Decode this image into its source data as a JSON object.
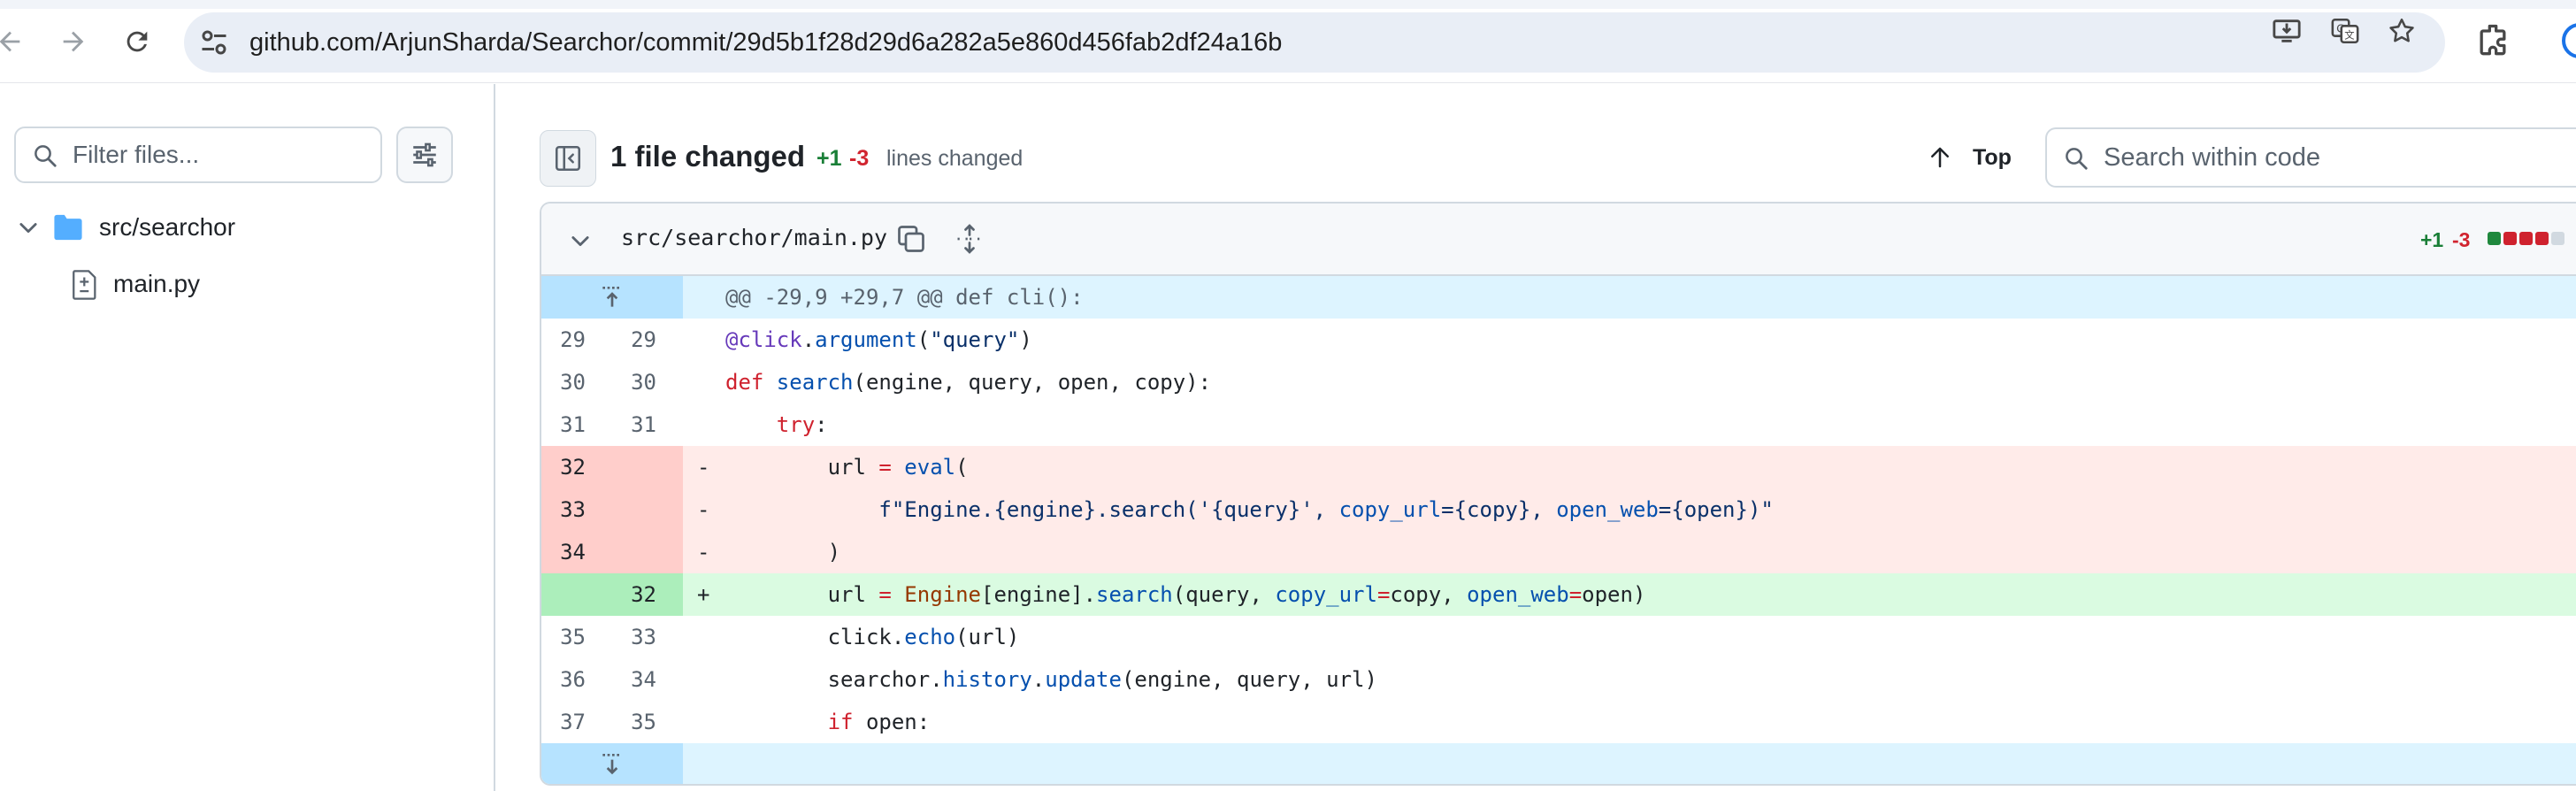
{
  "browser": {
    "url": "github.com/ArjunSharda/Searchor/commit/29d5b1f28d29d6a282a5e860d456fab2df24a16b",
    "icons": [
      "back-icon",
      "forward-icon",
      "reload-icon",
      "site-settings-icon",
      "install-app-icon",
      "translate-icon",
      "bookmark-star-icon",
      "extensions-icon"
    ]
  },
  "sidebar": {
    "filter_placeholder": "Filter files...",
    "tree": {
      "folder": "src/searchor",
      "file": "main.py"
    }
  },
  "header": {
    "files_changed": "1 file changed",
    "additions": "+1",
    "deletions": "-3",
    "lines_changed": "lines changed",
    "top_label": "Top",
    "search_placeholder": "Search within code"
  },
  "file": {
    "path": "src/searchor/main.py",
    "additions": "+1",
    "deletions": "-3",
    "diffstat_colors": [
      "#1f883d",
      "#cf222e",
      "#cf222e",
      "#cf222e",
      "#d1d9e0"
    ],
    "hunk_header": "@@ -29,9 +29,7 @@ def cli():"
  },
  "diff_lines": [
    {
      "type": "ctx",
      "old": "29",
      "new": "29",
      "marker": "",
      "tokens": [
        [
          "dec",
          "@click"
        ],
        [
          "",
          "."
        ],
        [
          "fn",
          "argument"
        ],
        [
          "",
          "("
        ],
        [
          "str",
          "\"query\""
        ],
        [
          "",
          ")"
        ]
      ]
    },
    {
      "type": "ctx",
      "old": "30",
      "new": "30",
      "marker": "",
      "tokens": [
        [
          "kw",
          "def "
        ],
        [
          "fn",
          "search"
        ],
        [
          "",
          "(engine, query, open, copy):"
        ]
      ]
    },
    {
      "type": "ctx",
      "old": "31",
      "new": "31",
      "marker": "",
      "tokens": [
        [
          "",
          "    "
        ],
        [
          "kw",
          "try"
        ],
        [
          "",
          ":"
        ]
      ]
    },
    {
      "type": "del",
      "old": "32",
      "new": "",
      "marker": "-",
      "tokens": [
        [
          "",
          "        url "
        ],
        [
          "kw",
          "="
        ],
        [
          "fn",
          " eval"
        ],
        [
          "",
          "("
        ]
      ]
    },
    {
      "type": "del",
      "old": "33",
      "new": "",
      "marker": "-",
      "tokens": [
        [
          "",
          "            "
        ],
        [
          "str",
          "f\"Engine.{engine}.search('{query}', "
        ],
        [
          "kwarg",
          "copy_url"
        ],
        [
          "str",
          "={copy}, "
        ],
        [
          "kwarg",
          "open_web"
        ],
        [
          "str",
          "={open})\""
        ]
      ]
    },
    {
      "type": "del",
      "old": "34",
      "new": "",
      "marker": "-",
      "tokens": [
        [
          "",
          "        )"
        ]
      ]
    },
    {
      "type": "add",
      "old": "",
      "new": "32",
      "marker": "+",
      "tokens": [
        [
          "",
          "        url "
        ],
        [
          "kw",
          "="
        ],
        [
          "cls",
          " Engine"
        ],
        [
          "",
          "[engine]."
        ],
        [
          "fn",
          "search"
        ],
        [
          "",
          "(query, "
        ],
        [
          "kwarg",
          "copy_url"
        ],
        [
          "kw",
          "="
        ],
        [
          "",
          "copy, "
        ],
        [
          "kwarg",
          "open_web"
        ],
        [
          "kw",
          "="
        ],
        [
          "",
          "open)"
        ]
      ]
    },
    {
      "type": "ctx",
      "old": "35",
      "new": "33",
      "marker": "",
      "tokens": [
        [
          "",
          "        click."
        ],
        [
          "fn",
          "echo"
        ],
        [
          "",
          "(url)"
        ]
      ]
    },
    {
      "type": "ctx",
      "old": "36",
      "new": "34",
      "marker": "",
      "tokens": [
        [
          "",
          "        searchor."
        ],
        [
          "fn",
          "history"
        ],
        [
          "",
          "."
        ],
        [
          "fn",
          "update"
        ],
        [
          "",
          "(engine, query, url)"
        ]
      ]
    },
    {
      "type": "ctx",
      "old": "37",
      "new": "35",
      "marker": "",
      "tokens": [
        [
          "",
          "        "
        ],
        [
          "kw",
          "if"
        ],
        [
          "",
          " open:"
        ]
      ]
    }
  ]
}
